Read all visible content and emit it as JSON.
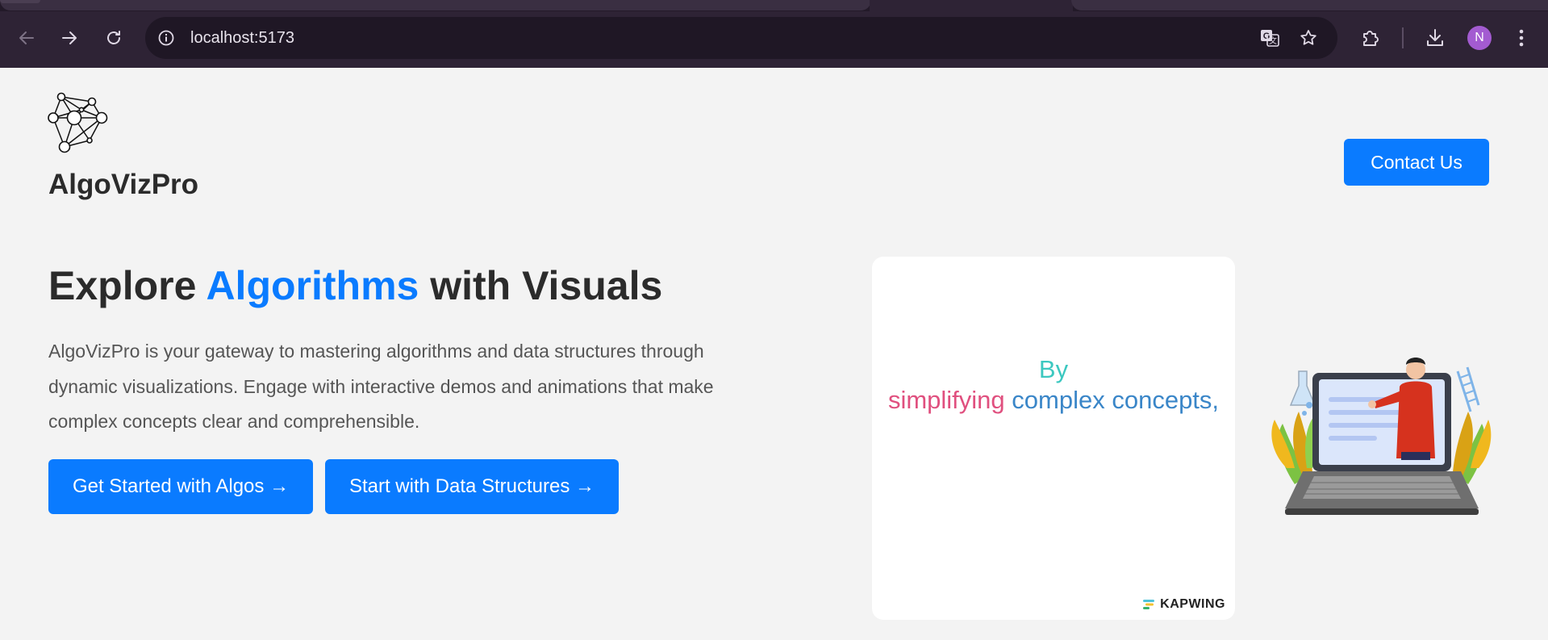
{
  "browser": {
    "url": "localhost:5173",
    "profile_initial": "N",
    "icons": {
      "back": "arrow-left-icon",
      "forward": "arrow-right-icon",
      "reload": "reload-icon",
      "site_info": "info-icon",
      "translate": "translate-icon",
      "bookmark": "star-icon",
      "extensions": "puzzle-icon",
      "downloads": "download-icon",
      "menu": "kebab-menu-icon"
    },
    "colors": {
      "frame": "#2e2335",
      "omnibox": "#1f1725",
      "avatar": "#a35bd1"
    }
  },
  "header": {
    "brand": "AlgoVizPro",
    "logo_icon": "network-graph-icon",
    "contact_label": "Contact Us"
  },
  "hero": {
    "headline_before": "Explore ",
    "headline_accent": "Algorithms",
    "headline_after": " with Visuals",
    "description": "AlgoVizPro is your gateway to mastering algorithms and data structures through dynamic visualizations. Engage with interactive demos and animations that make complex concepts clear and comprehensible.",
    "cta_primary": "Get Started with Algos →",
    "cta_secondary": "Start with Data Structures →"
  },
  "media": {
    "caption_line1": "By",
    "caption_pink": "simplifying",
    "caption_blue": "complex concepts,",
    "watermark": "KAPWING",
    "illustration": "teacher-laptop-illustration"
  },
  "colors": {
    "primary": "#0a7bff",
    "text_dark": "#2b2b2b",
    "text_muted": "#555555",
    "background": "#f3f3f3",
    "caption_teal": "#3cc8c0",
    "caption_pink": "#e0507f",
    "caption_blue": "#3a86c8"
  }
}
